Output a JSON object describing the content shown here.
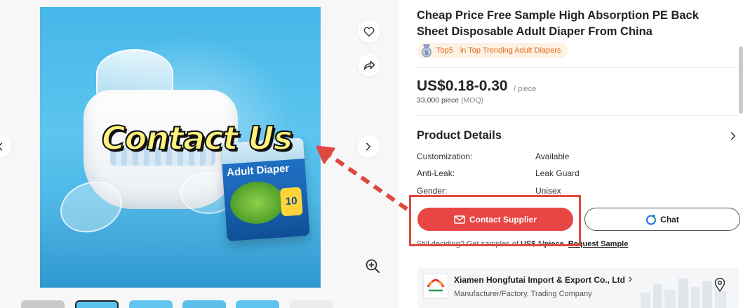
{
  "gallery": {
    "overlay_text": "Contact Us",
    "pack_label": "Adult Diaper",
    "pack_count": "10",
    "icons": {
      "favorite": "heart-icon",
      "share": "share-icon",
      "next": "chevron-right-icon",
      "prev": "chevron-left-icon",
      "zoom": "zoom-in-icon"
    }
  },
  "product": {
    "title": "Cheap Price Free Sample High Absorption PE Back Sheet Disposable Adult Diaper From China",
    "badge": {
      "rank": "Top5",
      "category": "in Top Trending Adult Diapers"
    },
    "price": "US$0.18-0.30",
    "price_unit": "/ piece",
    "moq_value": "33,000 piece",
    "moq_label": "(MOQ)"
  },
  "details": {
    "title": "Product Details",
    "attributes": [
      {
        "key": "Customization:",
        "value": "Available"
      },
      {
        "key": "Anti-Leak:",
        "value": "Leak Guard"
      },
      {
        "key": "Gender:",
        "value": "Unisex"
      }
    ]
  },
  "actions": {
    "contact_label": "Contact Supplier",
    "chat_label": "Chat"
  },
  "sample": {
    "prefix": "Still deciding? Get samples of",
    "amount": "US$ 1/piece",
    "link": "Request Sample"
  },
  "supplier": {
    "name": "Xiamen Hongfutai Import & Export Co., Ltd",
    "type": "Manufacturer/Factory, Trading Company"
  },
  "colors": {
    "accent_red": "#e84545",
    "annotation_red": "#e0483f",
    "badge_orange": "#e06a1b",
    "badge_bg": "#fdf1e4"
  }
}
